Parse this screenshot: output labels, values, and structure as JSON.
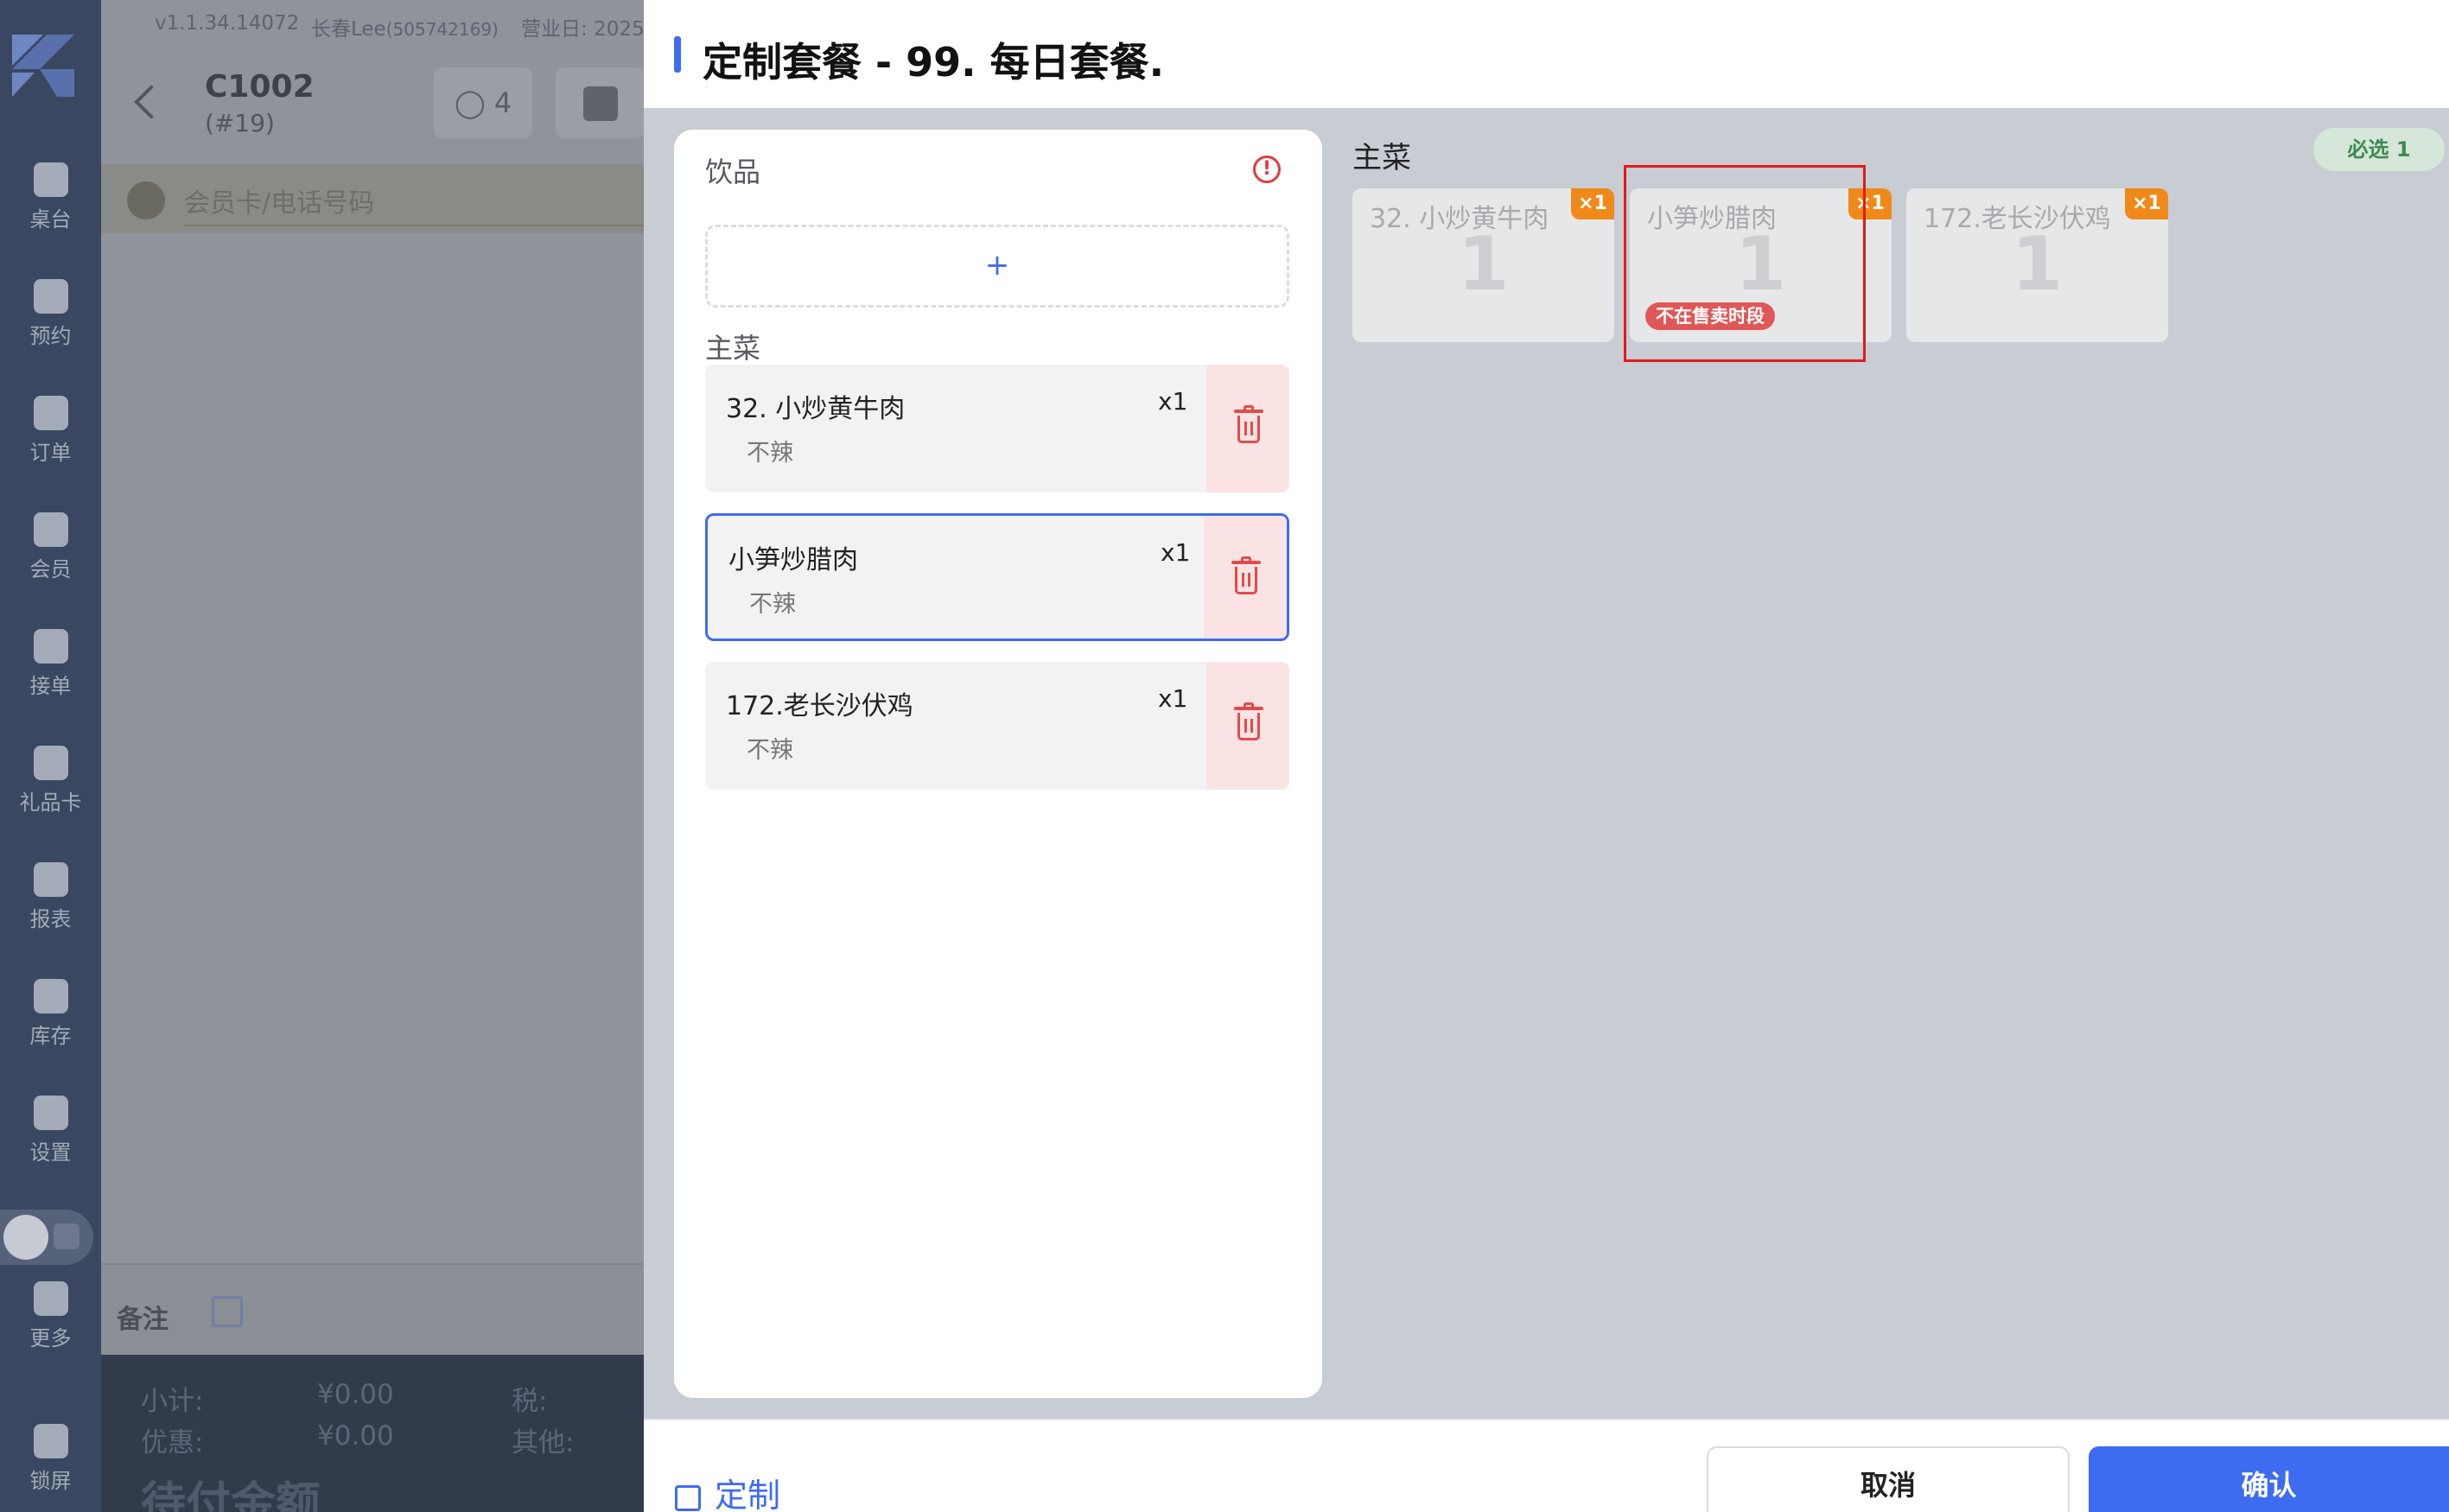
{
  "app": {
    "version": "v1.1.34.14072",
    "user": "长春Lee",
    "user_id": "(505742169)",
    "business_day_label": "营业日: 2025"
  },
  "nav": {
    "items": [
      {
        "label": "桌台",
        "icon": "table-icon"
      },
      {
        "label": "预约",
        "icon": "reservation-icon"
      },
      {
        "label": "订单",
        "icon": "order-icon"
      },
      {
        "label": "会员",
        "icon": "member-icon"
      },
      {
        "label": "接单",
        "icon": "accept-order-icon"
      },
      {
        "label": "礼品卡",
        "icon": "gift-card-icon"
      },
      {
        "label": "报表",
        "icon": "report-icon"
      },
      {
        "label": "库存",
        "icon": "inventory-icon"
      },
      {
        "label": "设置",
        "icon": "settings-icon"
      },
      {
        "label": "更多",
        "icon": "more-icon"
      },
      {
        "label": "锁屏",
        "icon": "lock-icon"
      }
    ]
  },
  "order": {
    "table": "C1002",
    "order_no": "(#19)",
    "guests": "4",
    "member_placeholder": "会员卡/电话号码",
    "note_label": "备注",
    "subtotal_label": "小计:",
    "subtotal_value": "¥0.00",
    "tax_label": "税:",
    "discount_label": "优惠:",
    "discount_value": "¥0.00",
    "other_label": "其他:",
    "amount_due_label": "待付金额"
  },
  "modal": {
    "title": "定制套餐 - 99. 每日套餐.",
    "left": {
      "drinks_title": "饮品",
      "add_label": "+",
      "mains_title": "主菜",
      "selected": [
        {
          "name": "32. 小炒黄牛肉",
          "qty": "x1",
          "option": "不辣",
          "active": false
        },
        {
          "name": "小笋炒腊肉",
          "qty": "x1",
          "option": "不辣",
          "active": true
        },
        {
          "name": "172.老长沙伏鸡",
          "qty": "x1",
          "option": "不辣",
          "active": false
        }
      ]
    },
    "right": {
      "title": "主菜",
      "required_label": "必选 1",
      "dishes": [
        {
          "name": "32. 小炒黄牛肉",
          "count": "1",
          "badge": "×1",
          "tag": ""
        },
        {
          "name": "小笋炒腊肉",
          "count": "1",
          "badge": "×1",
          "tag": "不在售卖时段"
        },
        {
          "name": "172.老长沙伏鸡",
          "count": "1",
          "badge": "×1",
          "tag": ""
        }
      ]
    },
    "footer": {
      "custom_label": "定制",
      "cancel_label": "取消",
      "confirm_label": "确认"
    }
  },
  "colors": {
    "accent": "#3d6cf0",
    "danger": "#e24b4b",
    "badge": "#ef8a1a",
    "success": "#3f8a52"
  }
}
